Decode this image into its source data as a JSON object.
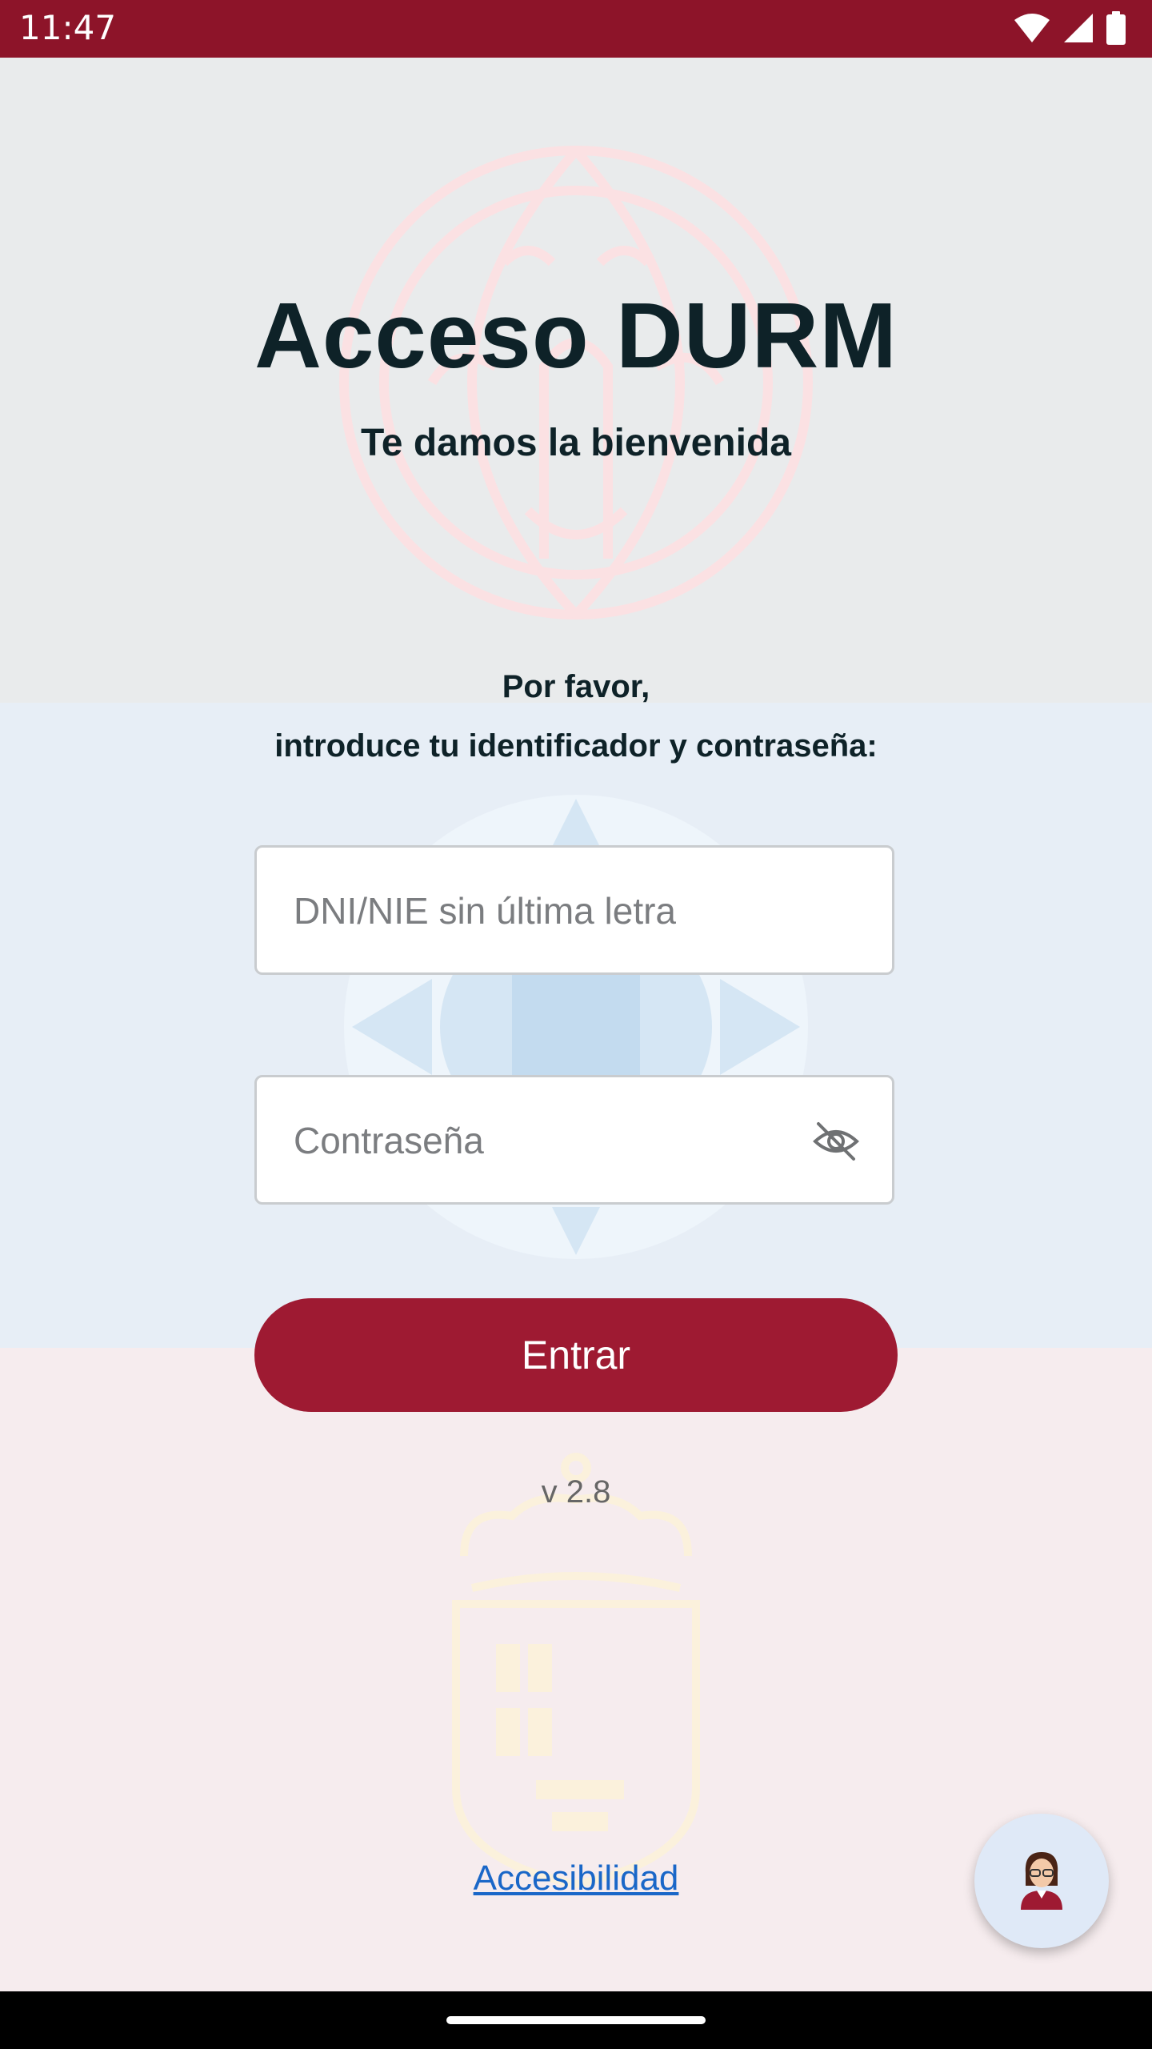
{
  "status_bar": {
    "time": "11:47",
    "icons": [
      "wifi-icon",
      "signal-icon",
      "battery-icon"
    ],
    "color": "#8d1429"
  },
  "header": {
    "title": "Acceso DURM",
    "subtitle": "Te damos la bienvenida"
  },
  "instructions": {
    "line1": "Por favor,",
    "line2": "introduce tu identificador y contraseña:"
  },
  "form": {
    "dni_placeholder": "DNI/NIE sin última letra",
    "dni_value": "",
    "password_placeholder": "Contraseña",
    "password_value": "",
    "password_toggle_icon": "eye-off-icon",
    "submit_label": "Entrar"
  },
  "footer": {
    "version": "v 2.8",
    "accessibility_label": "Accesibilidad"
  },
  "assistant": {
    "icon": "assistant-avatar-icon"
  },
  "colors": {
    "brand": "#9e1a32",
    "status_bar": "#8d1429",
    "link": "#1a67c8",
    "text_dark": "#0e2228",
    "band_top": "#e9ebec",
    "band_middle": "#e7eef6",
    "band_bottom": "#f6ecee"
  }
}
